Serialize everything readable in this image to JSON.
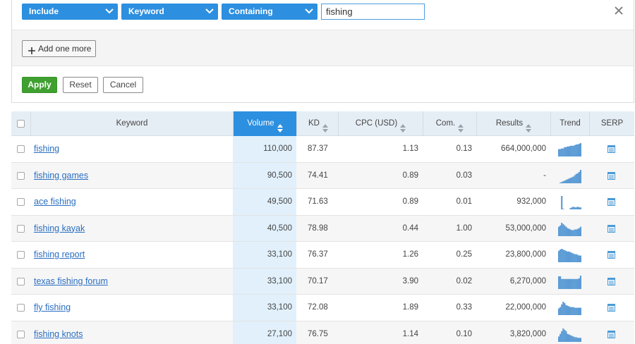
{
  "filter": {
    "include_label": "Include",
    "keyword_label": "Keyword",
    "containing_label": "Containing",
    "value": "fishing",
    "add_label": "Add one more",
    "apply_label": "Apply",
    "reset_label": "Reset",
    "cancel_label": "Cancel"
  },
  "table": {
    "columns": {
      "keyword": "Keyword",
      "volume": "Volume",
      "kd": "KD",
      "cpc": "CPC (USD)",
      "com": "Com.",
      "results": "Results",
      "trend": "Trend",
      "serp": "SERP"
    },
    "rows": [
      {
        "keyword": "fishing",
        "volume": "110,000",
        "kd": "87.37",
        "cpc": "1.13",
        "com": "0.13",
        "results": "664,000,000",
        "trend": [
          0.55,
          0.55,
          0.6,
          0.6,
          0.7,
          0.7,
          0.75,
          0.75,
          0.8,
          0.8,
          0.8,
          0.85,
          0.9,
          0.9,
          0.95,
          1.0
        ]
      },
      {
        "keyword": "fishing games",
        "volume": "90,500",
        "kd": "74.41",
        "cpc": "0.89",
        "com": "0.03",
        "results": "-",
        "trend": [
          0.0,
          0.05,
          0.1,
          0.15,
          0.2,
          0.25,
          0.3,
          0.35,
          0.4,
          0.45,
          0.5,
          0.6,
          0.7,
          0.75,
          0.85,
          1.0
        ]
      },
      {
        "keyword": "ace fishing",
        "volume": "49,500",
        "kd": "71.63",
        "cpc": "0.89",
        "com": "0.01",
        "results": "932,000",
        "trend": [
          0.0,
          0.0,
          1.0,
          0.05,
          0.0,
          0.0,
          0.0,
          0.0,
          0.1,
          0.15,
          0.2,
          0.15,
          0.15,
          0.2,
          0.15,
          0.15
        ]
      },
      {
        "keyword": "fishing kayak",
        "volume": "40,500",
        "kd": "78.98",
        "cpc": "0.44",
        "com": "1.00",
        "results": "53,000,000",
        "trend": [
          0.7,
          0.8,
          1.0,
          0.9,
          0.8,
          0.7,
          0.6,
          0.55,
          0.5,
          0.45,
          0.45,
          0.5,
          0.5,
          0.55,
          0.6,
          0.7
        ]
      },
      {
        "keyword": "fishing report",
        "volume": "33,100",
        "kd": "76.37",
        "cpc": "1.26",
        "com": "0.25",
        "results": "23,800,000",
        "trend": [
          0.85,
          0.95,
          1.0,
          0.95,
          0.9,
          0.85,
          0.8,
          0.8,
          0.75,
          0.7,
          0.65,
          0.6,
          0.6,
          0.55,
          0.5,
          0.5
        ]
      },
      {
        "keyword": "texas fishing forum",
        "volume": "33,100",
        "kd": "70.17",
        "cpc": "3.90",
        "com": "0.02",
        "results": "6,270,000",
        "trend": [
          0.95,
          0.95,
          0.75,
          0.75,
          0.75,
          0.75,
          0.75,
          0.75,
          0.75,
          0.75,
          0.75,
          0.75,
          0.75,
          0.75,
          0.8,
          1.0
        ]
      },
      {
        "keyword": "fly fishing",
        "volume": "33,100",
        "kd": "72.08",
        "cpc": "1.89",
        "com": "0.33",
        "results": "22,000,000",
        "trend": [
          0.5,
          0.6,
          0.8,
          1.0,
          0.9,
          0.75,
          0.7,
          0.65,
          0.6,
          0.6,
          0.6,
          0.55,
          0.55,
          0.55,
          0.55,
          0.55
        ]
      },
      {
        "keyword": "fishing knots",
        "volume": "27,100",
        "kd": "76.75",
        "cpc": "1.14",
        "com": "0.10",
        "results": "3,820,000",
        "trend": [
          0.4,
          0.6,
          0.8,
          1.0,
          0.9,
          0.8,
          0.6,
          0.55,
          0.5,
          0.45,
          0.4,
          0.35,
          0.35,
          0.3,
          0.3,
          0.3
        ]
      }
    ]
  },
  "colors": {
    "accent": "#2c8fe0",
    "apply": "#3fa02f",
    "link": "#2a6ec1",
    "trend": "#5b9bd5",
    "serp": "#4a9ad6"
  }
}
